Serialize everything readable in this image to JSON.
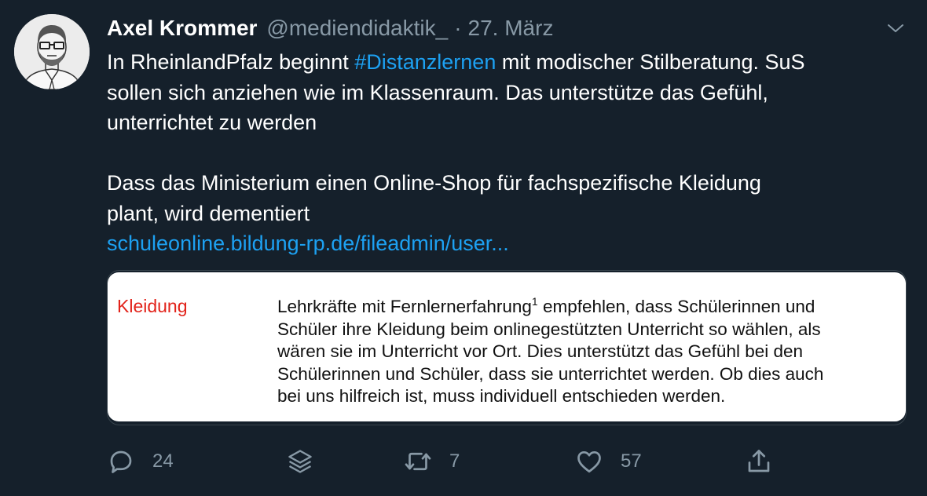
{
  "tweet": {
    "author": {
      "display_name": "Axel Krommer",
      "handle": "@mediendidaktik_",
      "separator": "·",
      "date": "27. März",
      "avatar_icon": "avatar-sketch-icon"
    },
    "menu_icon": "chevron-down-icon",
    "text": {
      "line1_prefix": "In RheinlandPfalz beginnt ",
      "hashtag": "#Distanzlernen",
      "line1_suffix": " mit modischer Stilberatung. SuS",
      "line2": "sollen sich anziehen wie im Klassenraum. Das unterstütze das Gefühl,",
      "line3": "unterrichtet zu werden",
      "line4": "Dass das Ministerium einen Online-Shop für fachspezifische Kleidung",
      "line5": "plant, wird dementiert",
      "url": "schuleonline.bildung-rp.de/fileadmin/user..."
    },
    "media": {
      "label": "Kleidung",
      "lines": [
        "Lehrkräfte mit Fernlernerfahrung",
        " empfehlen, dass Schülerinnen und",
        "Schüler ihre Kleidung beim onlinegestützten Unterricht so wählen, als",
        "wären sie im Unterricht vor Ort. Dies unterstützt das Gefühl bei den",
        "Schülerinnen und Schüler, dass sie unterrichtet werden. Ob dies auch",
        "bei uns hilfreich ist, muss individuell entschieden werden."
      ],
      "footnote": "1"
    },
    "actions": {
      "reply_count": "24",
      "retweet_count": "7",
      "like_count": "57",
      "icons": [
        "reply-icon",
        "stack-icon",
        "retweet-icon",
        "heart-icon",
        "share-icon"
      ],
      "icon_color": "#8899a6"
    }
  },
  "colors": {
    "background": "#15202b",
    "link": "#1da1f2",
    "secondary_text": "#8899a6",
    "doc_label": "#e2231a"
  }
}
